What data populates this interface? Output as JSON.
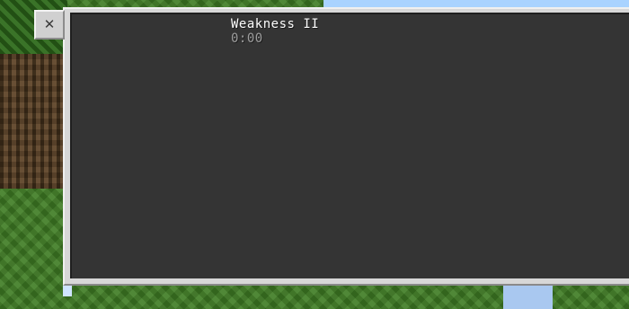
{
  "background": {
    "scene": "minecraft-grass-and-tree",
    "colors": {
      "grass": "#3f7d24",
      "leaves": "#2e6a1b",
      "trunk": "#5b4023",
      "sky": "#a9d3ff"
    }
  },
  "panel": {
    "close_icon": "close-icon",
    "close_glyph": "✕",
    "colors": {
      "frame": "#d7d7d7",
      "body": "#343434"
    }
  },
  "effects": [
    {
      "name": "Weakness II",
      "duration": "0:00"
    }
  ]
}
